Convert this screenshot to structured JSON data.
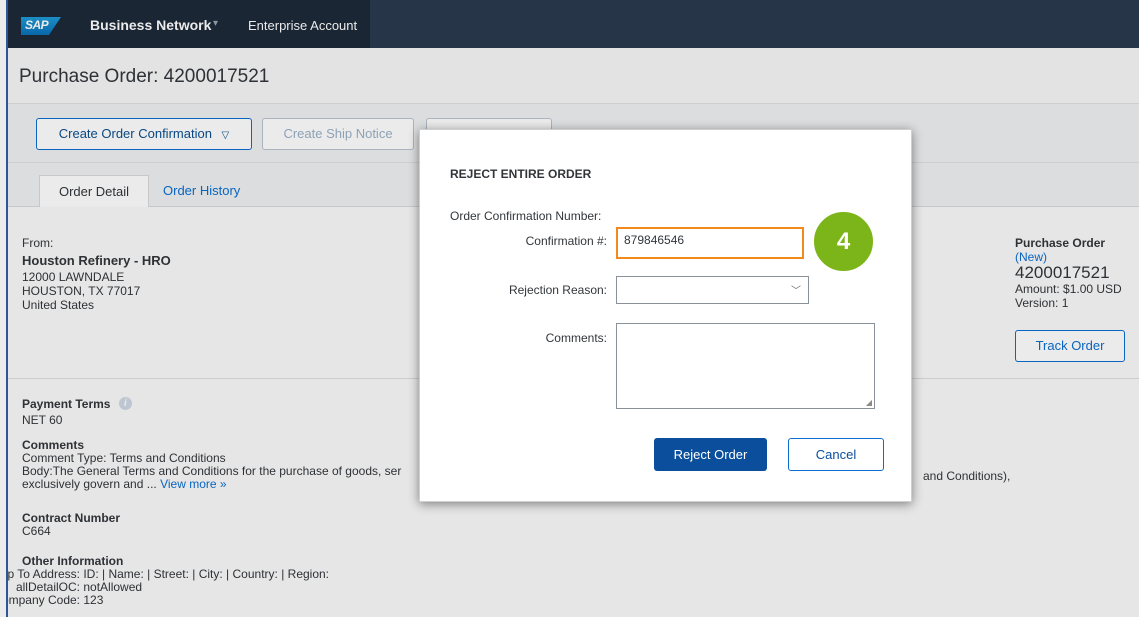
{
  "shell": {
    "logo": "SAP",
    "product": "Business Network",
    "product_chevron": "chevron-down-icon",
    "account": "Enterprise Account"
  },
  "page": {
    "title": "Purchase Order: 4200017521"
  },
  "toolbar": {
    "create_confirmation": "Create Order Confirmation",
    "create_ship_notice": "Create Ship Notice"
  },
  "tabs": {
    "order_detail": "Order Detail",
    "order_history": "Order History"
  },
  "from": {
    "label": "From:",
    "name": "Houston Refinery - HRO",
    "address1": "12000 LAWNDALE",
    "address2": "HOUSTON, TX 77017",
    "country": "United States"
  },
  "po_summary": {
    "heading": "Purchase Order",
    "status": "(New)",
    "number": "4200017521",
    "amount": "Amount: $1.00 USD",
    "version": "Version: 1",
    "track_button": "Track Order"
  },
  "payment": {
    "label": "Payment Terms",
    "value": "NET 60"
  },
  "comments": {
    "label": "Comments",
    "type": "Comment Type: Terms and Conditions",
    "body_left": "Body:The General Terms and Conditions for the purchase of goods, ser",
    "body_right": "and Conditions),",
    "body_line2": "exclusively govern and ... ",
    "view_more": "View more »"
  },
  "contract": {
    "label": "Contract Number",
    "value": "C664"
  },
  "other_info": {
    "label": "Other Information",
    "rows": [
      {
        "key": "Primary Ship To Address:",
        "value": "ID: | Name: | Street: | City: | Country: | Region:"
      },
      {
        "key": "allDetailOC:",
        "value": "notAllowed"
      },
      {
        "key": "Company Code:",
        "value": "123"
      }
    ]
  },
  "dialog": {
    "title": "REJECT ENTIRE ORDER",
    "ocn_label": "Order Confirmation Number:",
    "confirmation_label": "Confirmation #:",
    "confirmation_value": "879846546",
    "rejection_label": "Rejection Reason:",
    "rejection_value": "",
    "comments_label": "Comments:",
    "reject_button": "Reject Order",
    "cancel_button": "Cancel"
  },
  "step_badge": "4",
  "colors": {
    "shell": "#2b3a4f",
    "accent": "#0a6ed1",
    "primary_button": "#0a4e9c",
    "highlight": "#f08a1c",
    "badge": "#7cb519"
  }
}
